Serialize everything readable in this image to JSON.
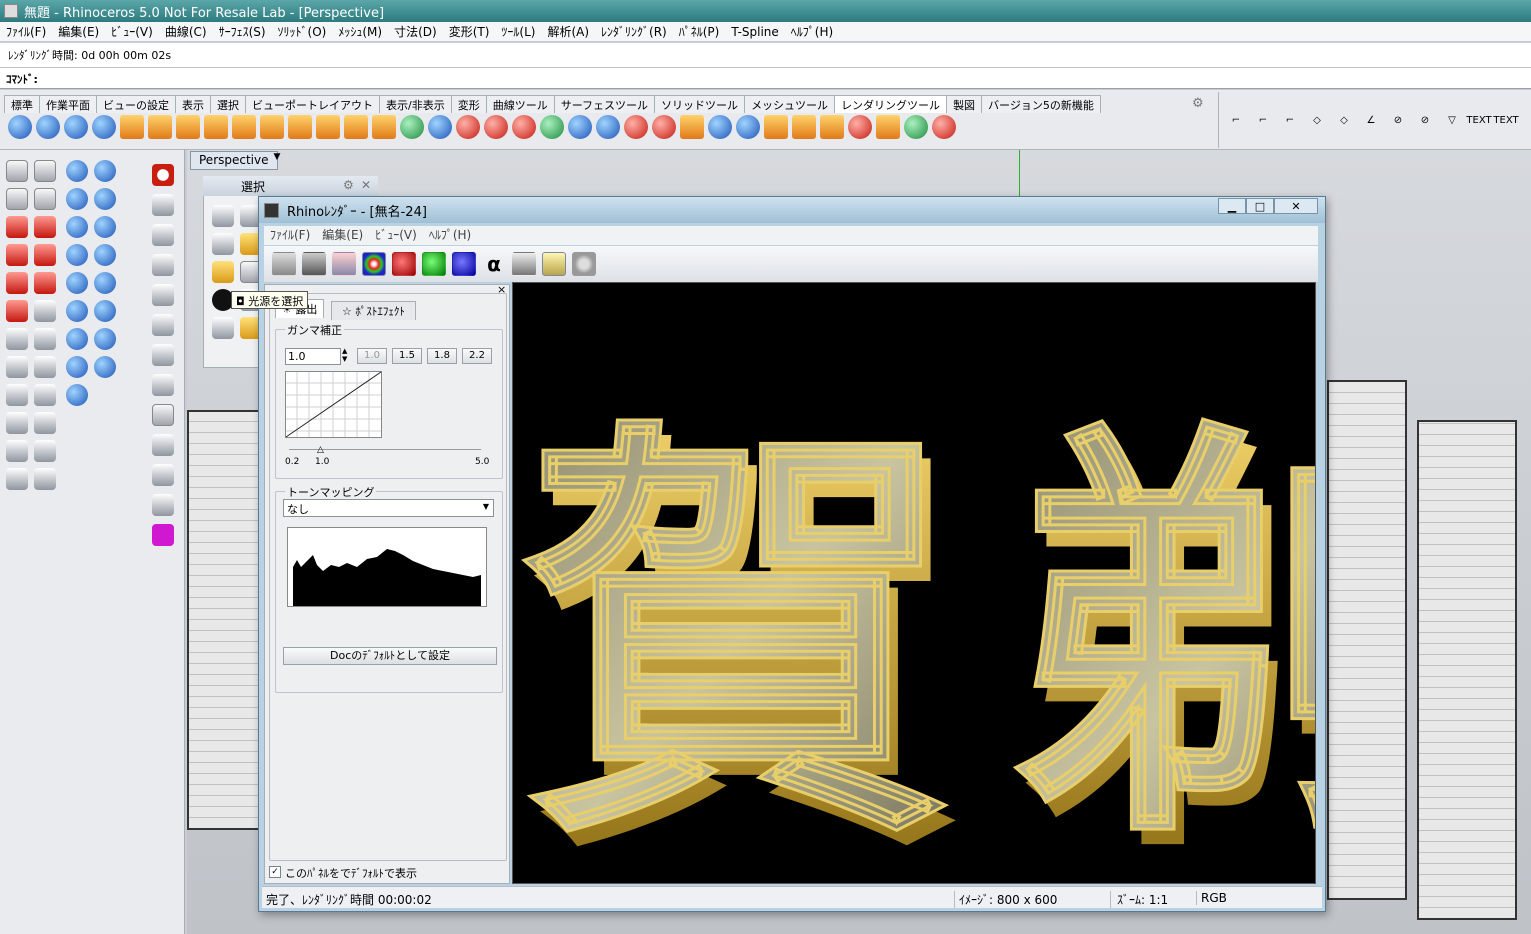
{
  "window": {
    "title": "無題 - Rhinoceros 5.0 Not For Resale Lab - [Perspective]"
  },
  "menu": [
    "ﾌｧｲﾙ(F)",
    "編集(E)",
    "ﾋﾞｭｰ(V)",
    "曲線(C)",
    "ｻｰﾌｪｽ(S)",
    "ｿﾘｯﾄﾞ(O)",
    "ﾒｯｼｭ(M)",
    "寸法(D)",
    "変形(T)",
    "ﾂｰﾙ(L)",
    "解析(A)",
    "ﾚﾝﾀﾞﾘﾝｸﾞ(R)",
    "ﾊﾟﾈﾙ(P)",
    "T-Spline",
    "ﾍﾙﾌﾟ(H)"
  ],
  "history": {
    "text": "ﾚﾝﾀﾞﾘﾝｸﾞ時間: 0d 00h 00m 02s"
  },
  "command": {
    "label": "ｺﾏﾝﾄﾞ:"
  },
  "toolbar_tabs": [
    "標準",
    "作業平面",
    "ビューの設定",
    "表示",
    "選択",
    "ビューポートレイアウト",
    "表示/非表示",
    "変形",
    "曲線ツール",
    "サーフェスツール",
    "ソリッドツール",
    "メッシュツール",
    "レンダリングツール",
    "製図",
    "バージョン5の新機能"
  ],
  "active_tab": "レンダリングツール",
  "right_tools": {
    "text1": "TEXT",
    "text2": "TEXT"
  },
  "viewport": {
    "name": "Perspective"
  },
  "select_panel": {
    "title": "選択"
  },
  "tooltip": {
    "text": "光源を選択"
  },
  "render_window": {
    "title": "Rhinoﾚﾝﾀﾞｰ - [無名-24]",
    "menu": [
      "ﾌｧｲﾙ(F)",
      "編集(E)",
      "ﾋﾞｭｰ(V)",
      "ﾍﾙﾌﾟ(H)"
    ],
    "tabs": {
      "exposure": "露出",
      "post": "ﾎﾟｽﾄｴﾌｪｸﾄ"
    },
    "gamma": {
      "label": "ガンマ補正",
      "value": "1.0",
      "presets": [
        "1.0",
        "1.5",
        "1.8",
        "2.2"
      ],
      "min": "0.2",
      "mid": "1.0",
      "max": "5.0"
    },
    "tonemap": {
      "label": "トーンマッピング",
      "selected": "なし"
    },
    "default_button": "Docのﾃﾞﾌｫﾙﾄとして設定",
    "show_default": "このﾊﾟﾈﾙをでﾃﾞﾌｫﾙﾄで表示",
    "status": {
      "left": "完了、ﾚﾝﾀﾞﾘﾝｸﾞ時間 00:00:02",
      "image": "ｲﾒｰｼﾞ: 800 x 600",
      "zoom": "ｽﾞｰﾑ: 1:1",
      "mode": "RGB"
    },
    "glyphs": [
      "賀",
      "剃"
    ]
  }
}
